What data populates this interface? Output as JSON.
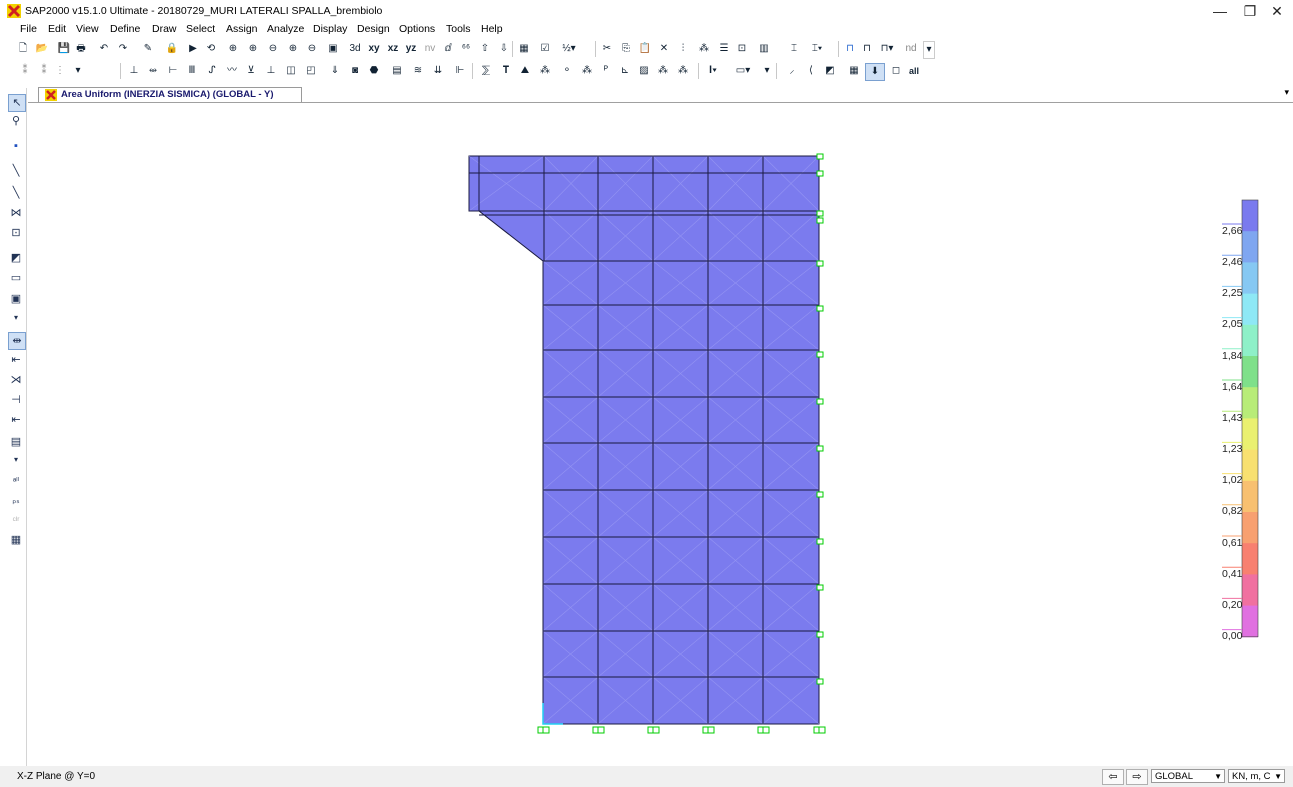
{
  "window": {
    "title": "SAP2000 v15.1.0 Ultimate  - 20180729_MURI LATERALI SPALLA_brembiolo",
    "app_icon": "sap-x-icon",
    "controls": [
      "—",
      "❐",
      "✕"
    ]
  },
  "menu": [
    "File",
    "Edit",
    "View",
    "Define",
    "Draw",
    "Select",
    "Assign",
    "Analyze",
    "Display",
    "Design",
    "Options",
    "Tools",
    "Help"
  ],
  "toolbar1": {
    "view_labels": [
      "xy",
      "xz",
      "yz",
      "nv"
    ],
    "nd_label": "nd"
  },
  "toolbar2": {
    "all_label": "all"
  },
  "tab": {
    "title": "Area Uniform (INERZIA SISMICA) (GLOBAL - Y)"
  },
  "legend": {
    "labels": [
      "2,66",
      "2,46",
      "2,25",
      "2,05",
      "1,84",
      "1,64",
      "1,43",
      "1,23",
      "1,02",
      "0,82",
      "0,61",
      "0,41",
      "0,20",
      "0,00"
    ],
    "colors": [
      "#7a7aee",
      "#7fa6f0",
      "#86c8f3",
      "#8ee8f5",
      "#8ef0c8",
      "#7fe08a",
      "#b8ec78",
      "#eaf070",
      "#f8e070",
      "#f8c070",
      "#f8a070",
      "#f88070",
      "#f070a0",
      "#e070e0"
    ]
  },
  "model": {
    "fill_color": "#7b7bee",
    "line_color": "#1a1a40",
    "restraint_color": "#00cc00"
  },
  "status": {
    "plane": "X-Z Plane @ Y=0",
    "coord_system": "GLOBAL",
    "units": "KN, m, C"
  }
}
